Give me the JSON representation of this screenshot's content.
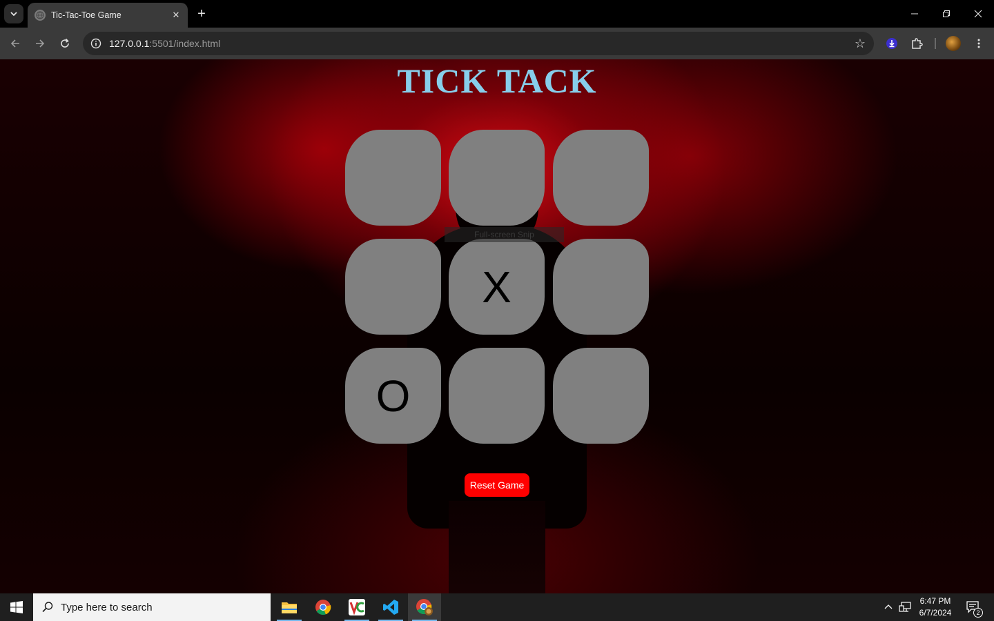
{
  "browser": {
    "tab_title": "Tic-Tac-Toe Game",
    "url_host": "127.0.0.1",
    "url_rest": ":5501/index.html"
  },
  "page": {
    "title": "TICK TACK",
    "cells": [
      "",
      "",
      "",
      "",
      "X",
      "",
      "O",
      "",
      ""
    ],
    "reset_label": "Reset Game",
    "tooltip": "Full-screen Snip",
    "colors": {
      "title": "#87ceeb",
      "cell": "#808080",
      "reset": "#ff0000"
    }
  },
  "taskbar": {
    "search_placeholder": "Type here to search",
    "time": "6:47 PM",
    "date": "6/7/2024",
    "notification_count": "2"
  }
}
